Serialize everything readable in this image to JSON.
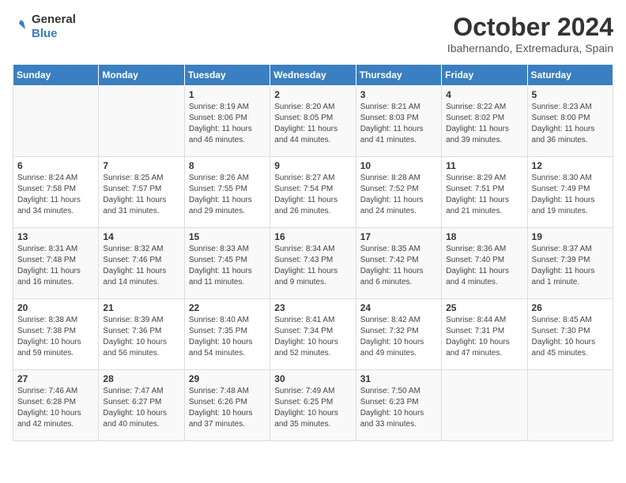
{
  "logo": {
    "line1": "General",
    "line2": "Blue"
  },
  "title": "October 2024",
  "subtitle": "Ibahernando, Extremadura, Spain",
  "days_header": [
    "Sunday",
    "Monday",
    "Tuesday",
    "Wednesday",
    "Thursday",
    "Friday",
    "Saturday"
  ],
  "weeks": [
    [
      {
        "day": "",
        "info": ""
      },
      {
        "day": "",
        "info": ""
      },
      {
        "day": "1",
        "info": "Sunrise: 8:19 AM\nSunset: 8:06 PM\nDaylight: 11 hours and 46 minutes."
      },
      {
        "day": "2",
        "info": "Sunrise: 8:20 AM\nSunset: 8:05 PM\nDaylight: 11 hours and 44 minutes."
      },
      {
        "day": "3",
        "info": "Sunrise: 8:21 AM\nSunset: 8:03 PM\nDaylight: 11 hours and 41 minutes."
      },
      {
        "day": "4",
        "info": "Sunrise: 8:22 AM\nSunset: 8:02 PM\nDaylight: 11 hours and 39 minutes."
      },
      {
        "day": "5",
        "info": "Sunrise: 8:23 AM\nSunset: 8:00 PM\nDaylight: 11 hours and 36 minutes."
      }
    ],
    [
      {
        "day": "6",
        "info": "Sunrise: 8:24 AM\nSunset: 7:58 PM\nDaylight: 11 hours and 34 minutes."
      },
      {
        "day": "7",
        "info": "Sunrise: 8:25 AM\nSunset: 7:57 PM\nDaylight: 11 hours and 31 minutes."
      },
      {
        "day": "8",
        "info": "Sunrise: 8:26 AM\nSunset: 7:55 PM\nDaylight: 11 hours and 29 minutes."
      },
      {
        "day": "9",
        "info": "Sunrise: 8:27 AM\nSunset: 7:54 PM\nDaylight: 11 hours and 26 minutes."
      },
      {
        "day": "10",
        "info": "Sunrise: 8:28 AM\nSunset: 7:52 PM\nDaylight: 11 hours and 24 minutes."
      },
      {
        "day": "11",
        "info": "Sunrise: 8:29 AM\nSunset: 7:51 PM\nDaylight: 11 hours and 21 minutes."
      },
      {
        "day": "12",
        "info": "Sunrise: 8:30 AM\nSunset: 7:49 PM\nDaylight: 11 hours and 19 minutes."
      }
    ],
    [
      {
        "day": "13",
        "info": "Sunrise: 8:31 AM\nSunset: 7:48 PM\nDaylight: 11 hours and 16 minutes."
      },
      {
        "day": "14",
        "info": "Sunrise: 8:32 AM\nSunset: 7:46 PM\nDaylight: 11 hours and 14 minutes."
      },
      {
        "day": "15",
        "info": "Sunrise: 8:33 AM\nSunset: 7:45 PM\nDaylight: 11 hours and 11 minutes."
      },
      {
        "day": "16",
        "info": "Sunrise: 8:34 AM\nSunset: 7:43 PM\nDaylight: 11 hours and 9 minutes."
      },
      {
        "day": "17",
        "info": "Sunrise: 8:35 AM\nSunset: 7:42 PM\nDaylight: 11 hours and 6 minutes."
      },
      {
        "day": "18",
        "info": "Sunrise: 8:36 AM\nSunset: 7:40 PM\nDaylight: 11 hours and 4 minutes."
      },
      {
        "day": "19",
        "info": "Sunrise: 8:37 AM\nSunset: 7:39 PM\nDaylight: 11 hours and 1 minute."
      }
    ],
    [
      {
        "day": "20",
        "info": "Sunrise: 8:38 AM\nSunset: 7:38 PM\nDaylight: 10 hours and 59 minutes."
      },
      {
        "day": "21",
        "info": "Sunrise: 8:39 AM\nSunset: 7:36 PM\nDaylight: 10 hours and 56 minutes."
      },
      {
        "day": "22",
        "info": "Sunrise: 8:40 AM\nSunset: 7:35 PM\nDaylight: 10 hours and 54 minutes."
      },
      {
        "day": "23",
        "info": "Sunrise: 8:41 AM\nSunset: 7:34 PM\nDaylight: 10 hours and 52 minutes."
      },
      {
        "day": "24",
        "info": "Sunrise: 8:42 AM\nSunset: 7:32 PM\nDaylight: 10 hours and 49 minutes."
      },
      {
        "day": "25",
        "info": "Sunrise: 8:44 AM\nSunset: 7:31 PM\nDaylight: 10 hours and 47 minutes."
      },
      {
        "day": "26",
        "info": "Sunrise: 8:45 AM\nSunset: 7:30 PM\nDaylight: 10 hours and 45 minutes."
      }
    ],
    [
      {
        "day": "27",
        "info": "Sunrise: 7:46 AM\nSunset: 6:28 PM\nDaylight: 10 hours and 42 minutes."
      },
      {
        "day": "28",
        "info": "Sunrise: 7:47 AM\nSunset: 6:27 PM\nDaylight: 10 hours and 40 minutes."
      },
      {
        "day": "29",
        "info": "Sunrise: 7:48 AM\nSunset: 6:26 PM\nDaylight: 10 hours and 37 minutes."
      },
      {
        "day": "30",
        "info": "Sunrise: 7:49 AM\nSunset: 6:25 PM\nDaylight: 10 hours and 35 minutes."
      },
      {
        "day": "31",
        "info": "Sunrise: 7:50 AM\nSunset: 6:23 PM\nDaylight: 10 hours and 33 minutes."
      },
      {
        "day": "",
        "info": ""
      },
      {
        "day": "",
        "info": ""
      }
    ]
  ]
}
